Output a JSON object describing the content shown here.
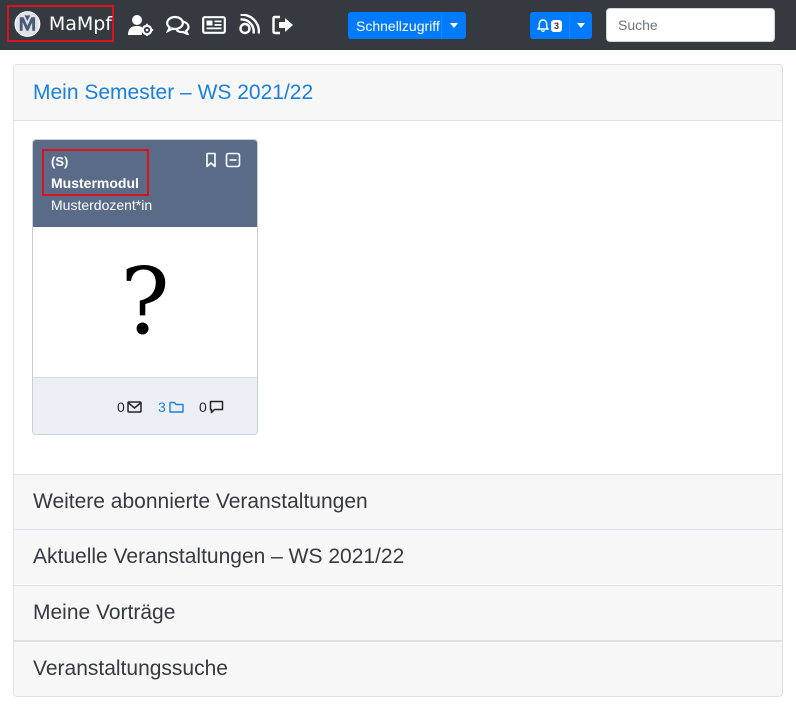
{
  "navbar": {
    "brand": "MaMpf",
    "quick_access": "Schnellzugriff",
    "notification_count": "3",
    "search_placeholder": "Suche"
  },
  "accordion": {
    "current_semester": "Mein Semester – WS 2021/22",
    "sections": [
      "Weitere abonnierte Veranstaltungen",
      "Aktuelle Veranstaltungen – WS 2021/22",
      "Meine Vorträge",
      "Veranstaltungssuche"
    ]
  },
  "course_card": {
    "type": "(S)",
    "title": "Mustermodul",
    "teacher": "Musterdozent*in",
    "thumbnail": "?",
    "stats": {
      "mail_count": "0",
      "folder_count": "3",
      "comment_count": "0"
    }
  },
  "colors": {
    "navbar_bg": "#343a40",
    "primary": "#007bff",
    "card_header": "#5a6b88",
    "highlight": "#d9121b",
    "link": "#1a7fdd"
  }
}
